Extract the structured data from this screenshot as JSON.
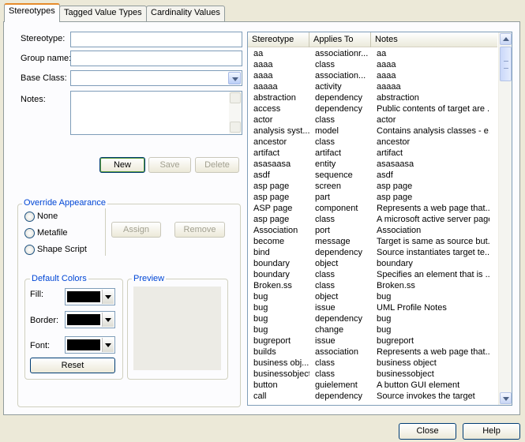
{
  "tabs": [
    {
      "label": "Stereotypes",
      "active": true
    },
    {
      "label": "Tagged Value Types",
      "active": false
    },
    {
      "label": "Cardinality Values",
      "active": false
    }
  ],
  "form": {
    "stereotype_label": "Stereotype:",
    "stereotype_value": "",
    "group_label": "Group name:",
    "group_value": "",
    "base_class_label": "Base Class:",
    "base_class_value": "",
    "notes_label": "Notes:",
    "notes_value": ""
  },
  "buttons": {
    "new": "New",
    "save": "Save",
    "delete": "Delete",
    "assign": "Assign",
    "remove": "Remove",
    "reset": "Reset",
    "close": "Close",
    "help": "Help"
  },
  "override": {
    "title": "Override Appearance",
    "options": [
      "None",
      "Metafile",
      "Shape Script"
    ]
  },
  "colors": {
    "title": "Default Colors",
    "fill_label": "Fill:",
    "border_label": "Border:",
    "font_label": "Font:",
    "swatch": "#000000"
  },
  "preview": {
    "title": "Preview"
  },
  "list": {
    "columns": [
      "Stereotype",
      "Applies To",
      "Notes"
    ],
    "rows": [
      [
        "aa",
        "associationr...",
        "aa"
      ],
      [
        "aaaa",
        "class",
        "aaaa"
      ],
      [
        "aaaa",
        "association...",
        "aaaa"
      ],
      [
        "aaaaa",
        "activity",
        "aaaaa"
      ],
      [
        "abstraction",
        "dependency",
        "abstraction"
      ],
      [
        "access",
        "dependency",
        "Public contents of target are ..."
      ],
      [
        "actor",
        "class",
        "actor"
      ],
      [
        "analysis syst...",
        "model",
        "Contains analysis classes - e..."
      ],
      [
        "ancestor",
        "class",
        "ancestor"
      ],
      [
        "artifact",
        "artifact",
        "artifact"
      ],
      [
        "asasaasa",
        "entity",
        "asasaasa"
      ],
      [
        "asdf",
        "sequence",
        "asdf"
      ],
      [
        "asp page",
        "screen",
        "asp page"
      ],
      [
        "asp page",
        "part",
        "asp page"
      ],
      [
        "ASP page",
        "component",
        "Represents a web page that..."
      ],
      [
        "asp page",
        "class",
        "A microsoft active server page"
      ],
      [
        "Association",
        "port",
        "Association"
      ],
      [
        "become",
        "message",
        "Target is same as source but..."
      ],
      [
        "bind",
        "dependency",
        "Source instantiates target te..."
      ],
      [
        "boundary",
        "object",
        "boundary"
      ],
      [
        "boundary",
        "class",
        "Specifies an element that is ..."
      ],
      [
        "Broken.ss",
        "class",
        "Broken.ss"
      ],
      [
        "bug",
        "object",
        "bug"
      ],
      [
        "bug",
        "issue",
        "UML Profile Notes"
      ],
      [
        "bug",
        "dependency",
        "bug"
      ],
      [
        "bug",
        "change",
        "bug"
      ],
      [
        "bugreport",
        "issue",
        "bugreport"
      ],
      [
        "builds",
        "association",
        "Represents a web page that..."
      ],
      [
        "business obj...",
        "class",
        "business object"
      ],
      [
        "businessobject",
        "class",
        "businessobject"
      ],
      [
        "button",
        "guielement",
        "A button GUI element"
      ],
      [
        "call",
        "dependency",
        "Source invokes the target"
      ]
    ]
  }
}
